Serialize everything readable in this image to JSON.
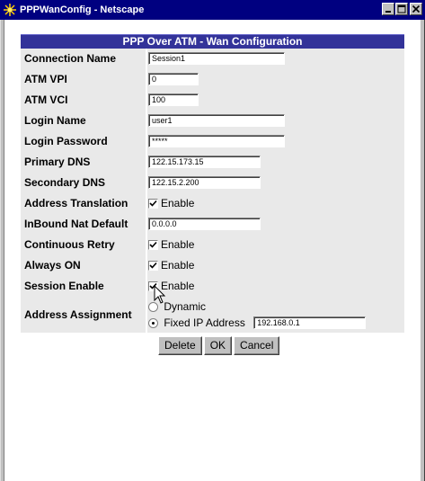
{
  "window": {
    "title": "PPPWanConfig - Netscape"
  },
  "form": {
    "heading": "PPP Over ATM - Wan Configuration",
    "fields": {
      "connection_name": {
        "label": "Connection Name",
        "value": "Session1"
      },
      "atm_vpi": {
        "label": "ATM VPI",
        "value": "0"
      },
      "atm_vci": {
        "label": "ATM VCI",
        "value": "100"
      },
      "login_name": {
        "label": "Login Name",
        "value": "user1"
      },
      "login_password": {
        "label": "Login Password",
        "value": "*****"
      },
      "primary_dns": {
        "label": "Primary DNS",
        "value": "122.15.173.15"
      },
      "secondary_dns": {
        "label": "Secondary DNS",
        "value": "122.15.2.200"
      },
      "address_translation": {
        "label": "Address Translation",
        "checkbox_label": "Enable",
        "checked": true
      },
      "inbound_nat_default": {
        "label": "InBound Nat Default",
        "value": "0.0.0.0"
      },
      "continuous_retry": {
        "label": "Continuous Retry",
        "checkbox_label": "Enable",
        "checked": true
      },
      "always_on": {
        "label": "Always ON",
        "checkbox_label": "Enable",
        "checked": true
      },
      "session_enable": {
        "label": "Session Enable",
        "checkbox_label": "Enable",
        "checked": true
      },
      "address_assignment": {
        "label": "Address Assignment",
        "option_dynamic": "Dynamic",
        "option_fixed": "Fixed IP Address",
        "selected": "fixed",
        "fixed_ip_value": "192.168.0.1"
      }
    },
    "buttons": {
      "delete": "Delete",
      "ok": "OK",
      "cancel": "Cancel"
    }
  },
  "colors": {
    "titlebar": "#000080",
    "header": "#333399",
    "row_bg": "#e9e9e9"
  }
}
